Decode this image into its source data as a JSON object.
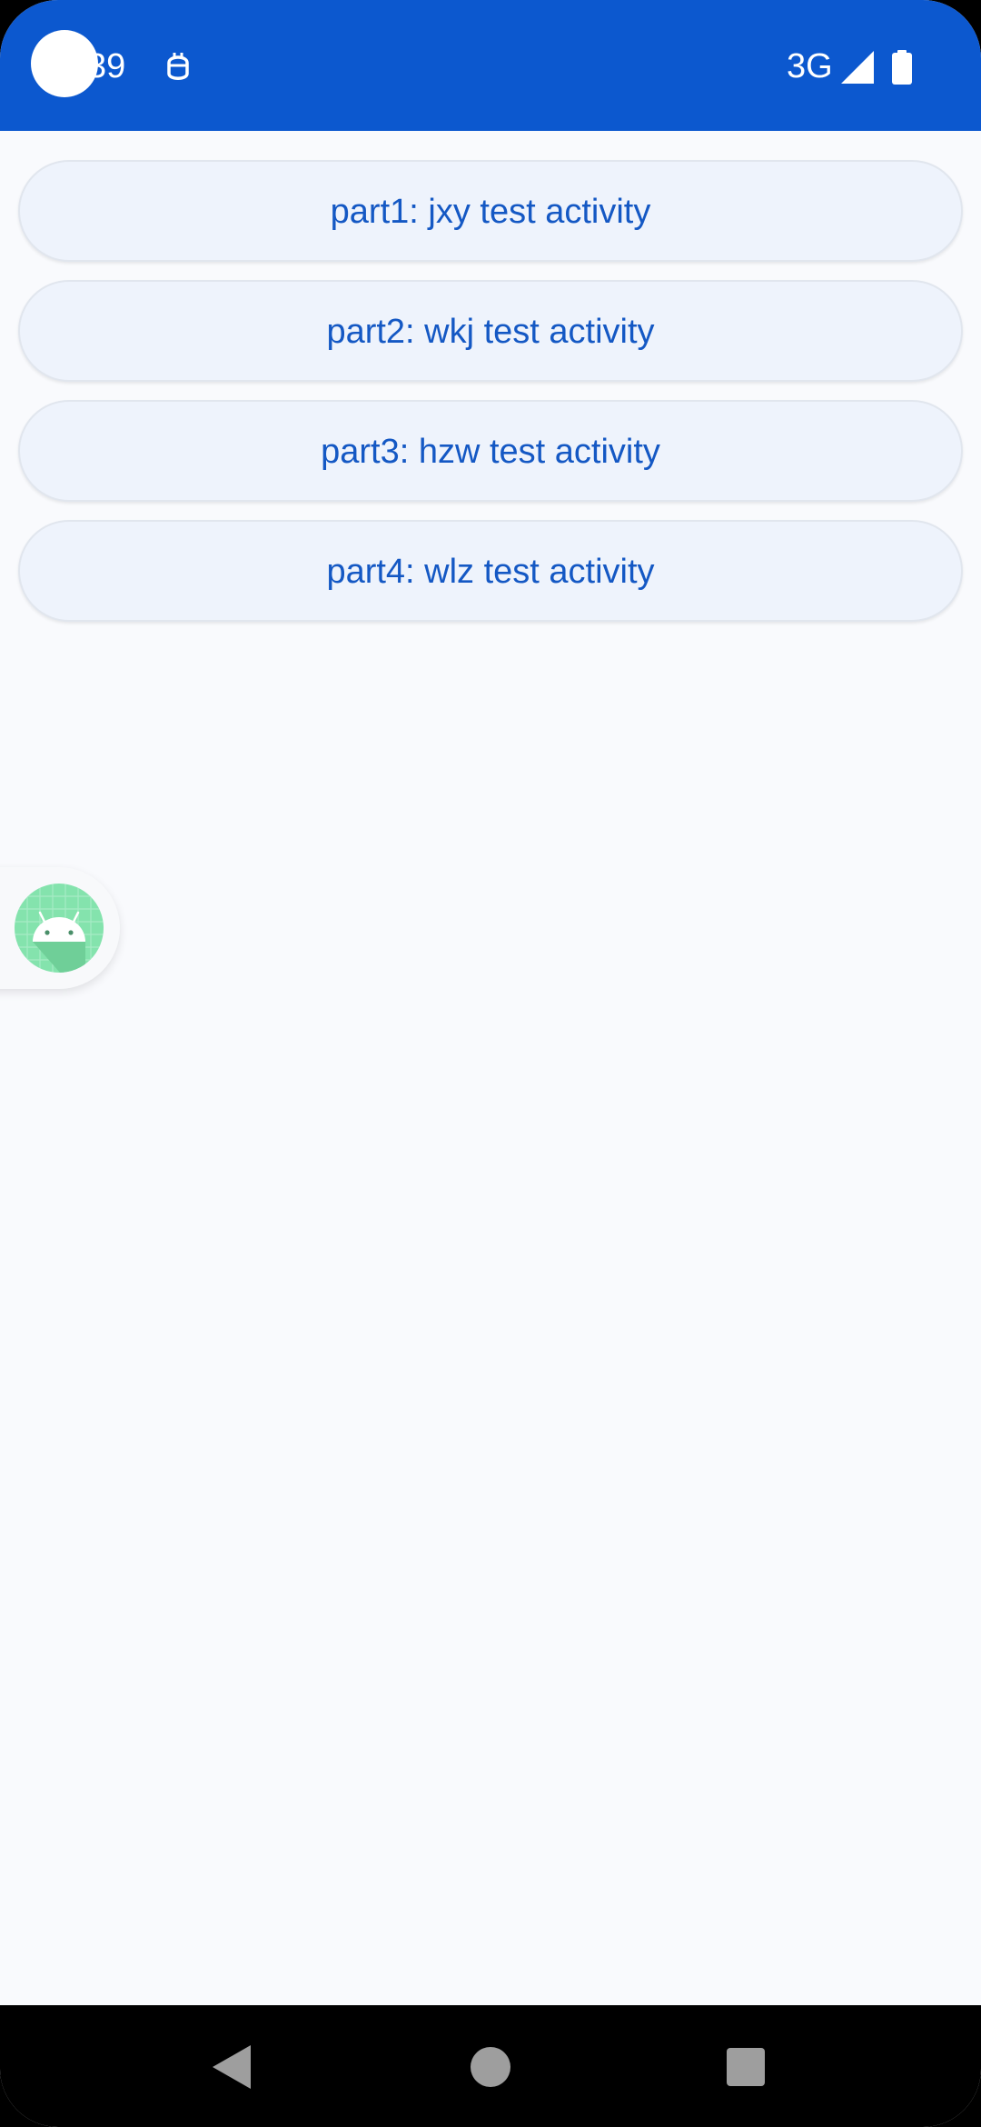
{
  "status_bar": {
    "time": "39",
    "network": "3G",
    "notification_icon": "privacy-mask-icon",
    "signal_icon": "cell-signal-icon",
    "battery_icon": "battery-icon",
    "background_color": "#0c58cf"
  },
  "buttons": [
    {
      "label": "part1: jxy test activity"
    },
    {
      "label": "part2: wkj test activity"
    },
    {
      "label": "part3: hzw test activity"
    },
    {
      "label": "part4: wlz test activity"
    }
  ],
  "floating_widget": {
    "icon": "android-icon"
  },
  "nav_bar": {
    "back_icon": "back-triangle-icon",
    "home_icon": "home-circle-icon",
    "recents_icon": "recents-square-icon"
  },
  "colors": {
    "accent": "#0c58cf",
    "button_text": "#1458c4",
    "button_background": "#eef3fc",
    "page_background": "#f9fafd"
  }
}
